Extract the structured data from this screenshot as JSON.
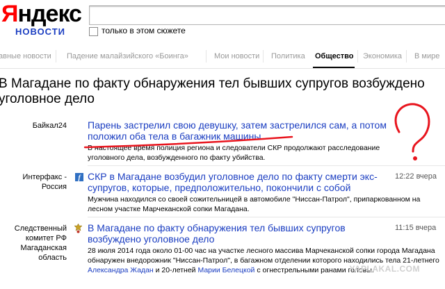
{
  "header": {
    "logo_text_first": "Я",
    "logo_text_rest": "ндекс",
    "logo_sub": "НОВОСТИ",
    "search_value": "",
    "checkbox_label": "только в этом сюжете"
  },
  "nav": {
    "items": [
      {
        "label": "авные новости",
        "active": false
      },
      {
        "label": "Падение малайзийского «Боинга»",
        "active": false
      },
      {
        "label": "Мои новости",
        "active": false
      },
      {
        "label": "Политика",
        "active": false
      },
      {
        "label": "Общество",
        "active": true
      },
      {
        "label": "Экономика",
        "active": false
      },
      {
        "label": "В мире",
        "active": false
      }
    ]
  },
  "headline": "В Магадане по факту обнаружения тел бывших супругов возбуждено уголовное дело",
  "articles": [
    {
      "source": "Байкал24",
      "title": "Парень застрелил свою девушку, затем застрелился сам, а потом положил оба тела в багажник машины",
      "text": "В настоящее время полиция региона и следователи СКР продолжают расследование уголовного дела, возбужденного по факту убийства.",
      "time": ""
    },
    {
      "source": "Интерфакс - Россия",
      "title": "СКР в Магадане возбудил уголовное дело по факту смерти экс-супругов, которые, предположительно, покончили с собой",
      "text": "Мужчина находился со своей сожительницей в автомобиле \"Ниссан-Патрол\", припаркованном на лесном участке Марчеканской сопки Магадана.",
      "time": "12:22 вчера"
    },
    {
      "source": "Следственный комитет РФ Магаданская область",
      "title": "В Магадане по факту обнаружения тел бывших супругов возбуждено уголовное дело",
      "text_a": "28 июля 2014 года около 01-00 час на участке лесного массива Марчеканской сопки города Магадана обнаружен внедорожник \"Ниссан-Патрол\", в багажном отделении которого находились тела 21-летнего ",
      "name1": "Александра Жадан",
      "text_b": " и 20-летней ",
      "name2": "Марии Белецкой",
      "text_c": " с огнестрельными ранами головы.",
      "time": "11:15 вчера"
    }
  ],
  "annotation": {
    "question_mark": "?",
    "color": "#e8141d"
  },
  "watermark": "YAPLAKAL.COM",
  "colors": {
    "link": "#1a3dc1",
    "logo_red": "#ff0000",
    "annotation_red": "#e8141d"
  }
}
